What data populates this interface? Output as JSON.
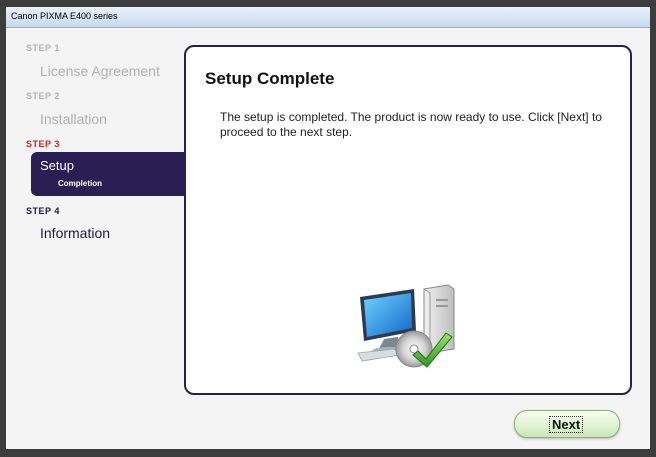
{
  "window": {
    "title": "Canon PIXMA E400 series"
  },
  "steps": [
    {
      "label": "STEP 1",
      "name": "License Agreement"
    },
    {
      "label": "STEP 2",
      "name": "Installation"
    },
    {
      "label": "STEP 3",
      "name": "Setup",
      "subname": "Completion"
    },
    {
      "label": "STEP 4",
      "name": "Information"
    }
  ],
  "panel": {
    "title": "Setup Complete",
    "text": "The setup is completed. The product is now ready to use. Click [Next] to proceed to the next step."
  },
  "buttons": {
    "next": "Next"
  },
  "colors": {
    "accent": "#2a1f52",
    "active_step": "#d81e1e",
    "inactive_step": "#b5b5b5"
  },
  "icons": {
    "illustration": "computer-with-cd-checkmark-icon"
  }
}
